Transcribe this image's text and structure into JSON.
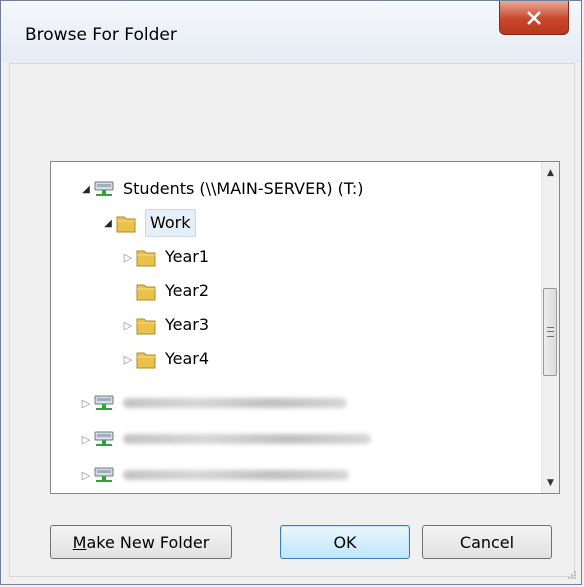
{
  "window": {
    "title": "Browse For Folder"
  },
  "colors": {
    "close_red": "#c9462a",
    "ok_accent": "#3c7fb1",
    "folder_yellow": "#e8c24a",
    "drive_green": "#2da640"
  },
  "tree": {
    "items": [
      {
        "label": "Students (\\\\MAIN-SERVER) (T:)",
        "icon": "network-drive-icon",
        "expander": "expanded",
        "depth": 0
      },
      {
        "label": "Work",
        "icon": "folder-icon",
        "expander": "expanded",
        "depth": 1,
        "selected": true
      },
      {
        "label": "Year1",
        "icon": "folder-icon",
        "expander": "collapsed",
        "depth": 2
      },
      {
        "label": "Year2",
        "icon": "folder-icon",
        "expander": "none",
        "depth": 2
      },
      {
        "label": "Year3",
        "icon": "folder-icon",
        "expander": "collapsed",
        "depth": 2
      },
      {
        "label": "Year4",
        "icon": "folder-icon",
        "expander": "collapsed",
        "depth": 2
      },
      {
        "label": "",
        "icon": "network-drive-icon",
        "expander": "collapsed",
        "depth": 0,
        "redacted": true
      },
      {
        "label": "",
        "icon": "network-drive-icon",
        "expander": "collapsed",
        "depth": 0,
        "redacted": true
      },
      {
        "label": "",
        "icon": "network-drive-icon",
        "expander": "collapsed",
        "depth": 0,
        "redacted": true
      }
    ]
  },
  "buttons": {
    "make_new_folder": "Make New Folder",
    "make_new_folder_mnemonic": "M",
    "make_new_folder_rest": "ake New Folder",
    "ok": "OK",
    "cancel": "Cancel"
  }
}
